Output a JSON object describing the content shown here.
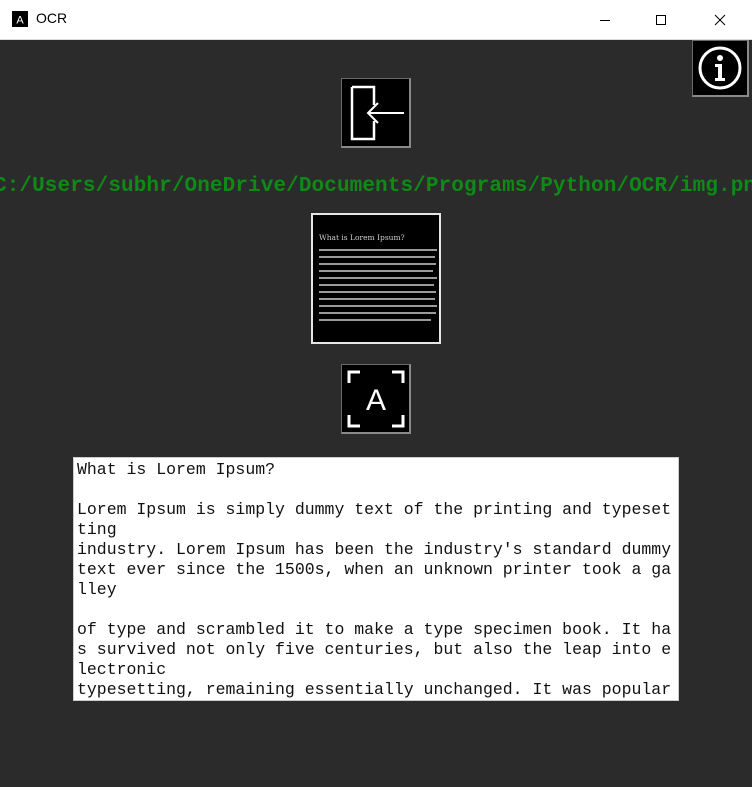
{
  "window": {
    "title": "OCR",
    "app_icon": "letter-a-icon",
    "controls": [
      "minimize-icon",
      "maximize-icon",
      "close-icon"
    ]
  },
  "toolbar": {
    "info_icon": "info-icon",
    "open_icon": "open-file-icon",
    "ocr_icon": "scan-text-icon",
    "ocr_glyph": "A"
  },
  "file": {
    "path": "C:/Users/subhr/OneDrive/Documents/Programs/Python/OCR/img.png"
  },
  "thumbnail": {
    "title": "What is Lorem Ipsum?"
  },
  "output": {
    "lines": [
      "What is Lorem Ipsum?",
      "",
      "Lorem Ipsum is simply dummy text of the printing and typeset",
      "ting",
      "industry. Lorem Ipsum has been the industry's standard dummy",
      "text ever since the 1500s, when an unknown printer took a ga",
      "lley",
      "",
      "of type and scrambled it to make a type specimen book. It ha",
      "s survived not only five centuries, but also the leap into e",
      "lectronic",
      "typesetting, remaining essentially unchanged. It was popular"
    ]
  },
  "colors": {
    "background": "#2b2b2b",
    "path_text": "#0f8a17",
    "button_bg": "#000000",
    "output_bg": "#ffffff"
  }
}
